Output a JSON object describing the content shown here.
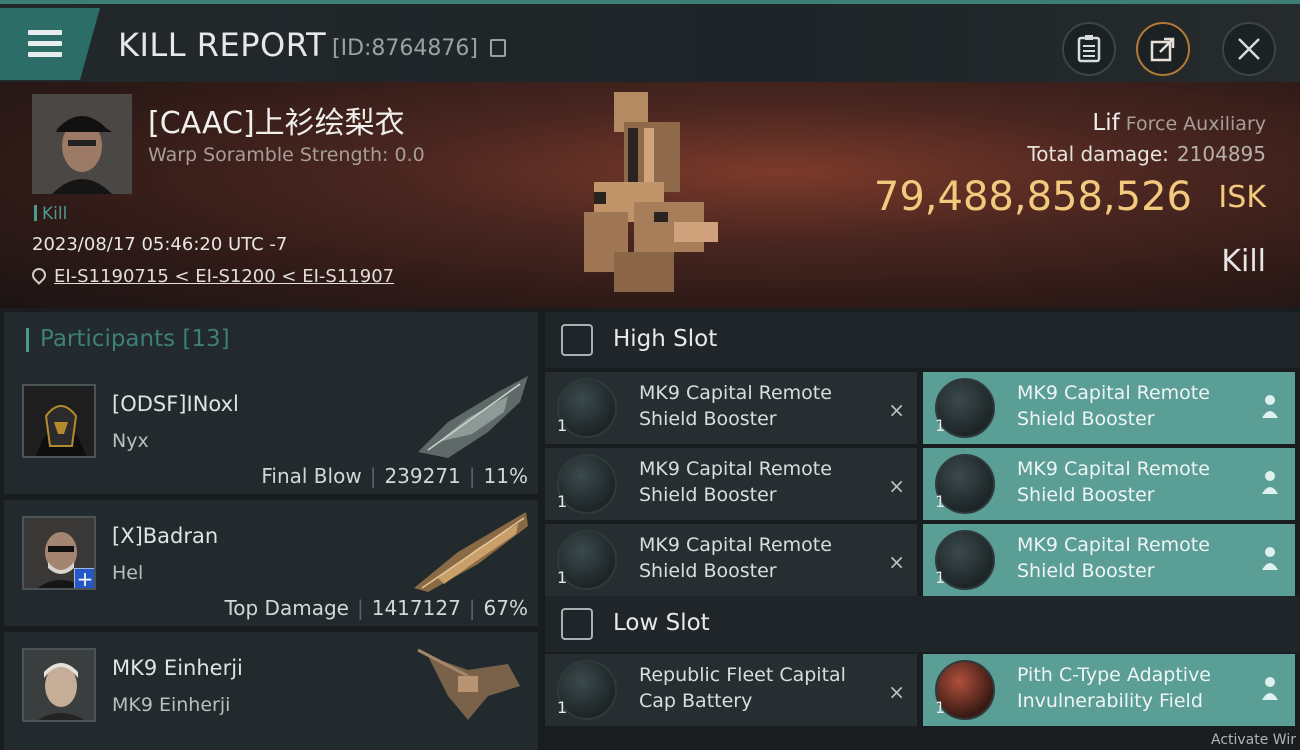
{
  "header": {
    "title": "KILL REPORT",
    "report_id": "[ID:8764876]"
  },
  "victim": {
    "name": "[CAAC]上衫绘梨衣",
    "warp_scramble": "Warp Soramble Strength: 0.0",
    "kill_tag": "Kill",
    "datetime": "2023/08/17 05:46:20 UTC -7",
    "location": "EI-S1190715 < EI-S1200 < EI-S11907",
    "ship_name": "Lif",
    "ship_class": "Force Auxiliary",
    "total_damage_label": "Total damage:",
    "total_damage": "2104895",
    "isk_value": "79,488,858,526",
    "isk_unit": "ISK",
    "result": "Kill"
  },
  "participants": {
    "label": "Participants [13]",
    "rows": [
      {
        "name": "[ODSF]INoxl",
        "ship": "Nyx",
        "role": "Final Blow",
        "damage": "239271",
        "pct": "11%"
      },
      {
        "name": "[X]Badran",
        "ship": "Hel",
        "role": "Top Damage",
        "damage": "1417127",
        "pct": "67%"
      },
      {
        "name": "MK9 Einherji",
        "ship": "MK9 Einherji",
        "role": "",
        "damage": "",
        "pct": ""
      }
    ]
  },
  "high_slot": {
    "label": "High Slot",
    "modules": [
      {
        "qty": "1",
        "name": "MK9 Capital Remote Shield Booster",
        "state": "destroyed"
      },
      {
        "qty": "1",
        "name": "MK9 Capital Remote Shield Booster",
        "state": "dropped"
      },
      {
        "qty": "1",
        "name": "MK9 Capital Remote Shield Booster",
        "state": "destroyed"
      },
      {
        "qty": "1",
        "name": "MK9 Capital Remote Shield Booster",
        "state": "dropped"
      },
      {
        "qty": "1",
        "name": "MK9 Capital Remote Shield Booster",
        "state": "destroyed"
      },
      {
        "qty": "1",
        "name": "MK9 Capital Remote Shield Booster",
        "state": "dropped"
      }
    ]
  },
  "low_slot": {
    "label": "Low Slot",
    "modules": [
      {
        "qty": "1",
        "name": "Republic Fleet Capital Cap Battery",
        "state": "destroyed"
      },
      {
        "qty": "1",
        "name": "Pith C-Type Adaptive Invulnerability Field",
        "state": "dropped"
      }
    ]
  },
  "icons": {
    "destroyed": "×"
  },
  "colors": {
    "accent": "#3e7e75",
    "isk": "#f3c97d",
    "fitted": "#5a9e96"
  },
  "watermark": "Activate Wir"
}
